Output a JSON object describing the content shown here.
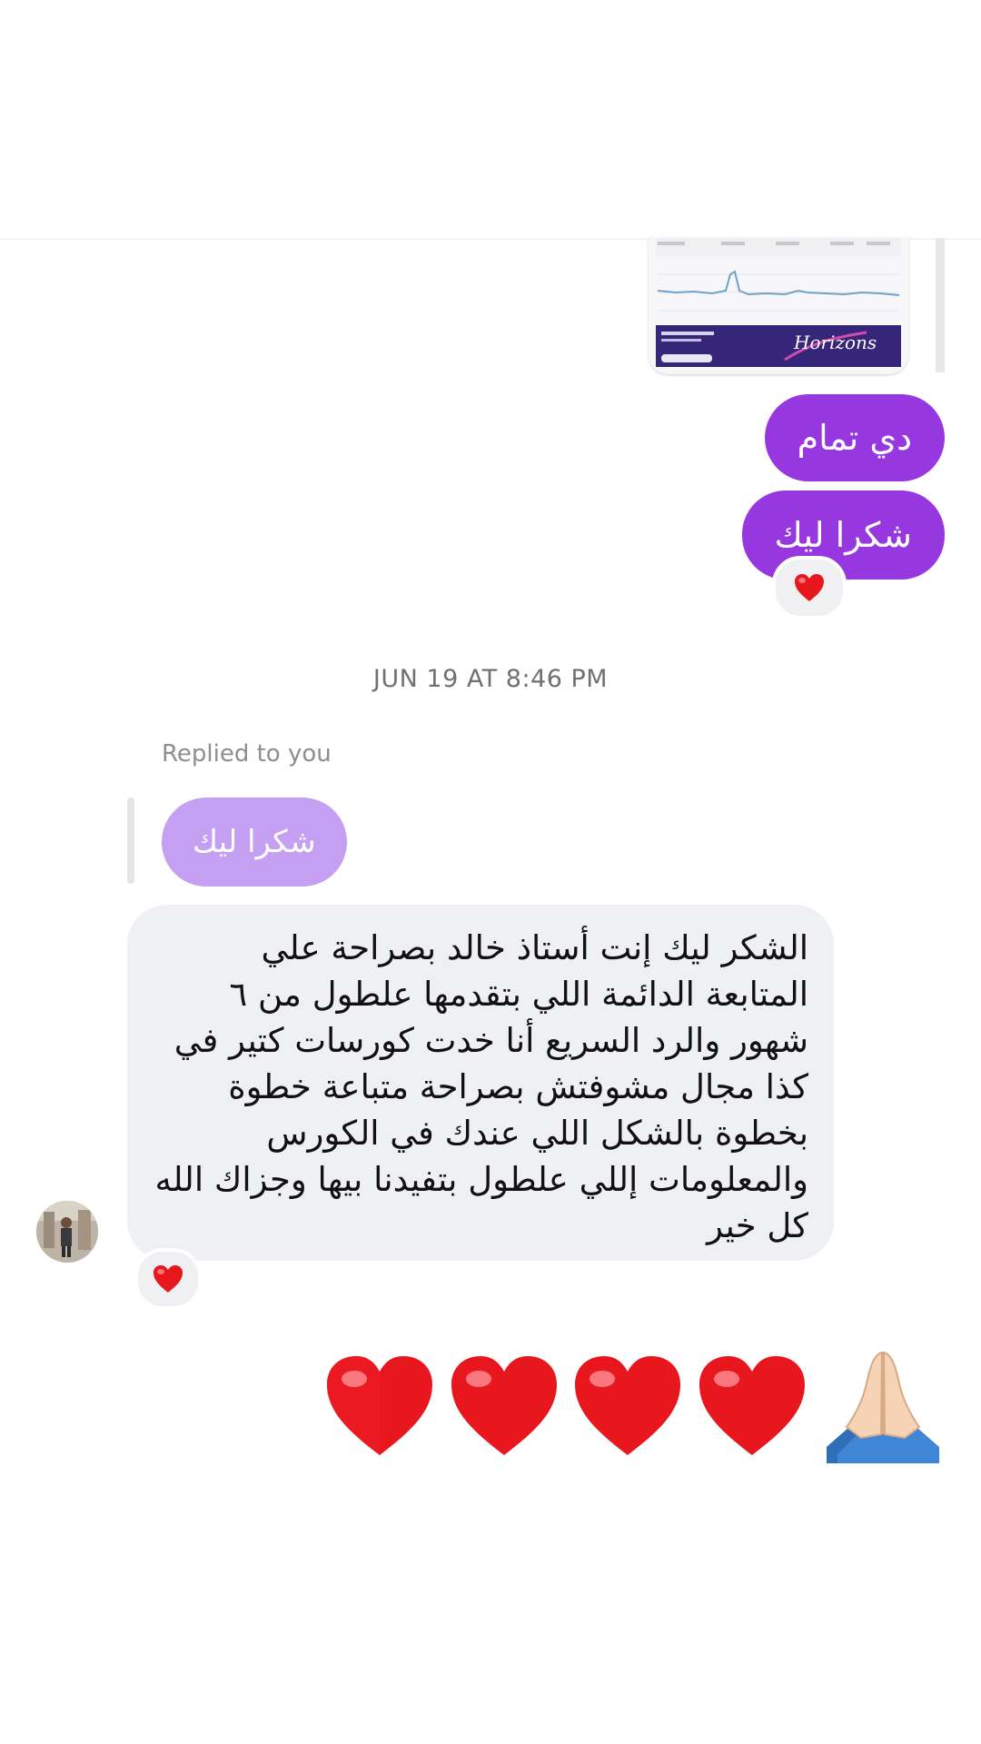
{
  "conversation": {
    "sent_image_caption": "Horizons",
    "outgoing_messages": [
      "دي تمام",
      "شكرا ليك"
    ],
    "reaction_emoji": "heart-icon",
    "timestamp": "JUN 19 AT 8:46 PM",
    "replied_label": "Replied to you",
    "replied_quote": "شكرا ليك",
    "incoming_message": "الشكر ليك إنت أستاذ خالد بصراحة علي\nالمتابعة الدائمة اللي بتقدمها علطول من ٦\nشهور والرد السريع أنا خدت كورسات كتير في\nكذا مجال مشوفتش بصراحة متباعة خطوة\nبخطوة  بالشكل اللي عندك في الكورس\nوالمعلومات إللي علطول بتفيدنا بيها وجزاك الله\nكل خير",
    "emoji_reply": [
      "heart-icon",
      "heart-icon",
      "heart-icon",
      "heart-icon",
      "folded-hands-icon"
    ]
  },
  "colors": {
    "outgoing_bubble": "#9737e0",
    "reply_quote_bubble": "#c59ff2",
    "incoming_bubble": "#eef0f3",
    "heart": "#e8171e"
  }
}
